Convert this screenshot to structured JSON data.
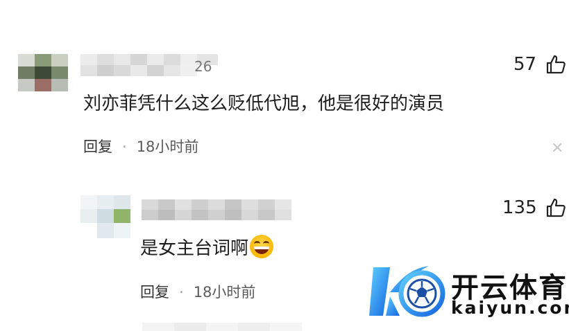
{
  "comments": [
    {
      "like_count": "57",
      "text": "刘亦菲凭什么这么贬低代旭，他是很好的演员",
      "reply_label": "回复",
      "separator": "·",
      "time": "18小时前",
      "username_partial": "26"
    },
    {
      "like_count": "135",
      "text": "是女主台词啊",
      "reply_label": "回复",
      "separator": "·",
      "time": "18小时前"
    }
  ],
  "close_glyph": "✕",
  "icons": {
    "like": "thumbs-up-icon",
    "close": "close-icon",
    "emoji": "laughing-emoji-icon"
  },
  "watermark": {
    "brand_cn": "开云体育",
    "brand_en": "kaiyun.com"
  },
  "colors": {
    "logo_blue": "#1f8ef1",
    "logo_cyan": "#5fd0ff",
    "text": "#1d1d1d",
    "meta": "#5a5a5a"
  }
}
